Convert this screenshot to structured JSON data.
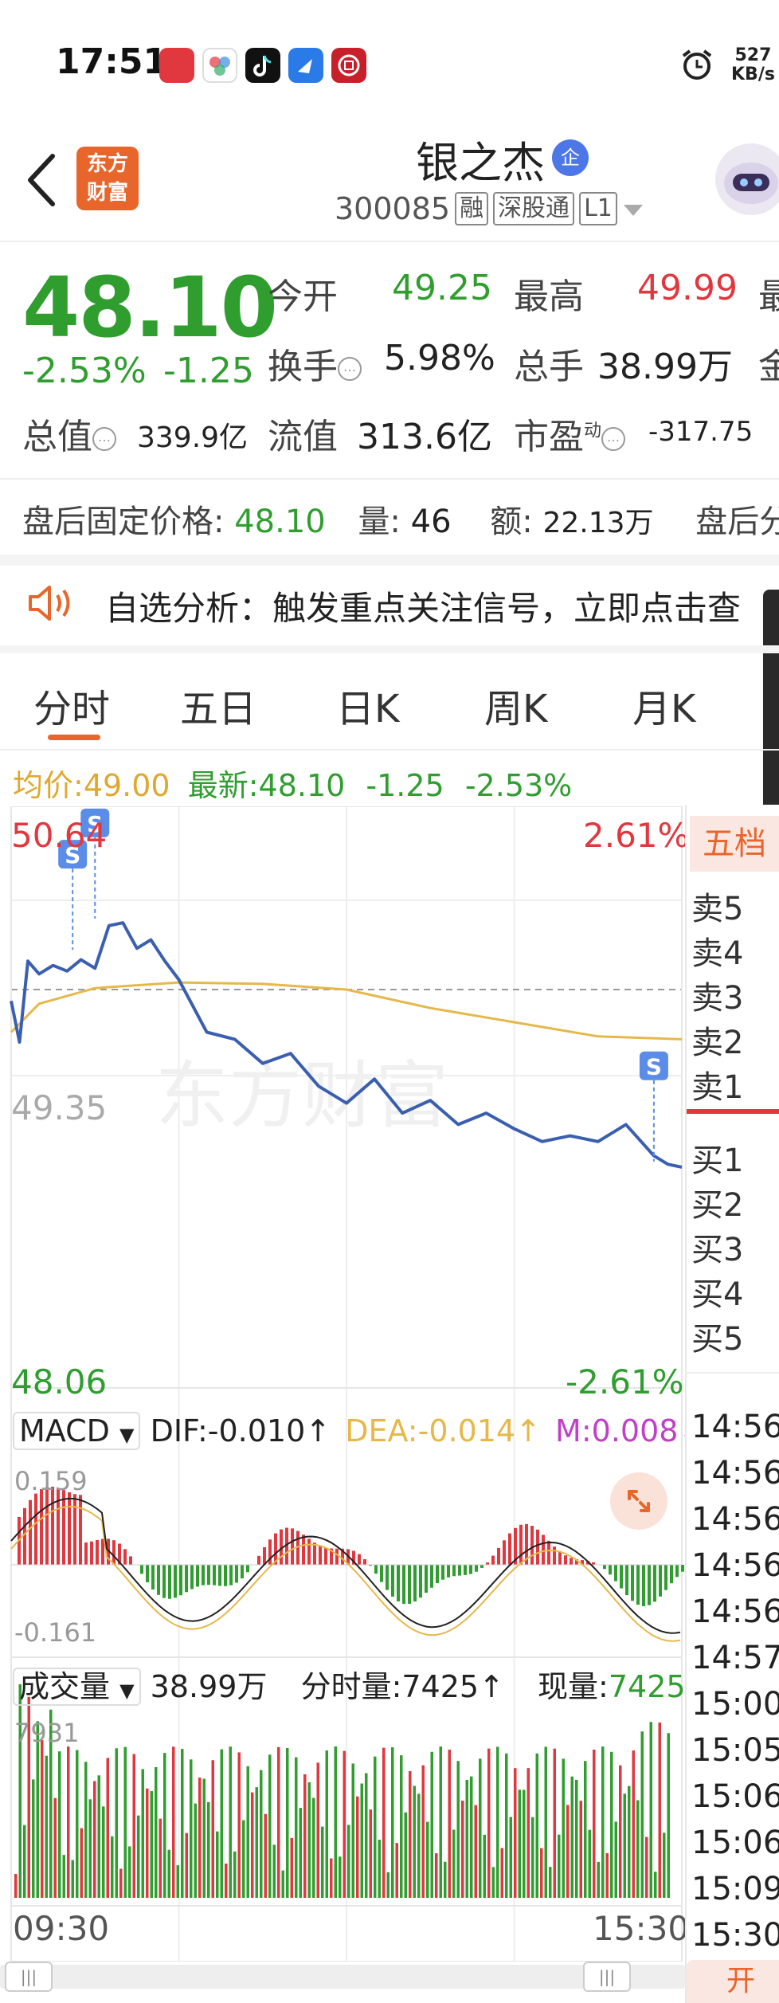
{
  "status_bar": {
    "time": "17:51",
    "net_speed_value": "527",
    "net_speed_unit": "KB/s",
    "app_icons": [
      "weibo-icon",
      "app-flower-icon",
      "tiktok-icon",
      "feishu-icon",
      "bank-icon"
    ]
  },
  "header": {
    "logo_line1": "东方",
    "logo_line2": "财富",
    "stock_name": "银之杰",
    "ent_badge": "企",
    "code": "300085",
    "tags": [
      "融",
      "深股通",
      "L1"
    ]
  },
  "quote": {
    "price": "48.10",
    "change_pct": "-2.53%",
    "change_abs": "-1.25",
    "open_label": "今开",
    "open_value": "49.25",
    "high_label": "最高",
    "high_value": "49.99",
    "turnover_label": "换手",
    "turnover_value": "5.98%",
    "volume_label": "总手",
    "volume_value": "38.99万",
    "mktcap_label": "总值",
    "mktcap_value": "339.9亿",
    "float_label": "流值",
    "float_value": "313.6亿",
    "pe_label": "市盈",
    "pe_sup": "动",
    "pe_value": "-317.75",
    "cut_label_1": "最",
    "cut_label_2": "金"
  },
  "after_hours": {
    "price_label": "盘后固定价格:",
    "price_value": "48.10",
    "vol_label": "量:",
    "vol_value": "46",
    "amt_label": "额:",
    "amt_value": "22.13万",
    "more_label": "盘后分"
  },
  "ticker": {
    "text": "自选分析：触发重点关注信号，立即点击查"
  },
  "tabs": [
    "分时",
    "五日",
    "日K",
    "周K",
    "月K"
  ],
  "avg_row": {
    "avg_label": "均价:",
    "avg_value": "49.00",
    "latest_label": "最新:",
    "latest_value": "48.10",
    "chg_abs": "-1.25",
    "chg_pct": "-2.53%"
  },
  "chart_labels": {
    "y_high": "50.64",
    "y_low": "48.06",
    "y_mid": "49.35",
    "pct_high": "2.61%",
    "pct_low": "-2.61%",
    "watermark": "东方财富",
    "signal": "S"
  },
  "chart_data": {
    "type": "line",
    "series": [
      {
        "name": "最新",
        "x": [
          "09:30",
          "09:33",
          "09:36",
          "09:40",
          "09:45",
          "09:50",
          "09:55",
          "10:00",
          "10:05",
          "10:10",
          "10:15",
          "10:20",
          "10:25",
          "10:30",
          "10:40",
          "10:50",
          "11:00",
          "11:10",
          "11:20",
          "11:30",
          "13:10",
          "13:20",
          "13:30",
          "13:40",
          "13:50",
          "14:00",
          "14:10",
          "14:20",
          "14:30",
          "14:40",
          "14:50",
          "14:55",
          "15:00"
        ],
        "values": [
          49.27,
          48.98,
          49.55,
          49.46,
          49.52,
          49.48,
          49.56,
          49.5,
          49.8,
          49.82,
          49.64,
          49.7,
          49.55,
          49.42,
          49.05,
          49.0,
          48.83,
          48.9,
          48.67,
          48.55,
          48.72,
          48.48,
          48.57,
          48.4,
          48.48,
          48.37,
          48.28,
          48.32,
          48.28,
          48.4,
          48.18,
          48.12,
          48.1
        ]
      },
      {
        "name": "均价",
        "x": [
          "09:30",
          "09:40",
          "10:00",
          "10:30",
          "11:00",
          "11:30",
          "13:30",
          "14:00",
          "14:30",
          "15:00"
        ],
        "values": [
          49.05,
          49.25,
          49.36,
          49.4,
          49.39,
          49.35,
          49.22,
          49.12,
          49.02,
          49.0
        ]
      }
    ],
    "signals": [
      {
        "label": "S",
        "time": "09:52",
        "price": 49.63
      },
      {
        "label": "S",
        "time": "10:00",
        "price": 49.85
      },
      {
        "label": "S",
        "time": "14:50",
        "price": 48.14
      }
    ],
    "ylim": [
      48.06,
      50.64
    ],
    "reference": 49.35,
    "x_start": "09:30",
    "x_end": "15:30"
  },
  "macd": {
    "selector": "MACD",
    "dif_label": "DIF:",
    "dif_value": "-0.010",
    "dea_label": "DEA:",
    "dea_value": "-0.014",
    "m_label": "M:",
    "m_value": "0.008",
    "y_high": "0.159",
    "y_low": "-0.161"
  },
  "volume": {
    "selector": "成交量",
    "total": "38.99万",
    "tick_label": "分时量:",
    "tick_value": "7425",
    "now_label": "现量:",
    "now_value": "7425",
    "y_max": "7931"
  },
  "time_axis": {
    "start": "09:30",
    "end": "15:30"
  },
  "order_book": {
    "header": "五档",
    "asks": [
      "卖5",
      "卖4",
      "卖3",
      "卖2",
      "卖1"
    ],
    "bids": [
      "买1",
      "买2",
      "买3",
      "买4",
      "买5"
    ],
    "ticks": [
      "14:56",
      "14:56",
      "14:56",
      "14:56",
      "14:56",
      "14:57",
      "15:00",
      "15:05",
      "15:06",
      "15:06",
      "15:09",
      "15:30"
    ],
    "open_button": "开通"
  },
  "colors": {
    "up": "#e0383e",
    "down": "#2f9e2f",
    "price_line": "#3a5fb0",
    "avg_line": "#e6b84a",
    "brand": "#e8652b",
    "signal": "#5b8de8"
  }
}
